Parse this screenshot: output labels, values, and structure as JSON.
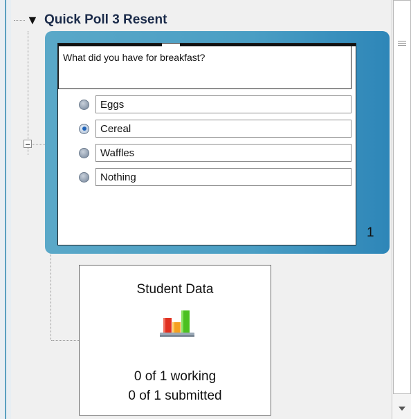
{
  "poll": {
    "title": "Quick Poll 3 Resent",
    "question": "What did you have for breakfast?",
    "options": [
      {
        "label": "Eggs",
        "selected": false
      },
      {
        "label": "Cereal",
        "selected": true
      },
      {
        "label": "Waffles",
        "selected": false
      },
      {
        "label": "Nothing",
        "selected": false
      }
    ],
    "page_number": "1"
  },
  "student_data": {
    "title": "Student Data",
    "working": "0 of 1 working",
    "submitted": "0 of 1 submitted",
    "icon": "bar-chart-icon"
  },
  "colors": {
    "card_blue": "#4a9ec4",
    "radio_selected": "#1f63b8",
    "bar_red": "#e03020",
    "bar_orange": "#f5a020",
    "bar_green": "#4cc020"
  }
}
